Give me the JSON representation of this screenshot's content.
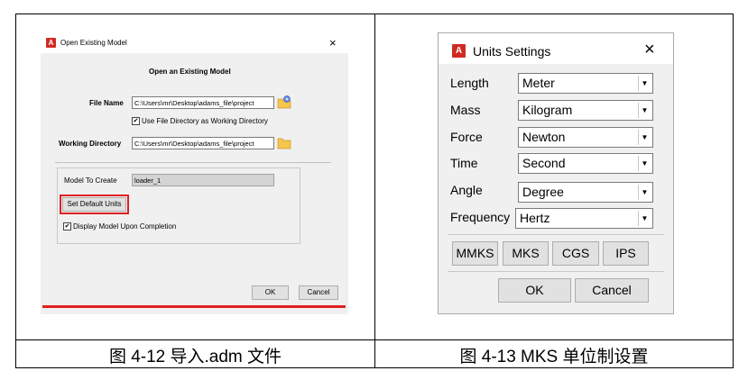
{
  "open_dialog": {
    "title": "Open Existing Model",
    "close_glyph": "×",
    "heading": "Open an Existing Model",
    "file_name_label": "File Name",
    "file_name_value": "C:\\Users\\mr\\Desktop\\adams_file\\project",
    "use_file_dir_label": "Use File Directory as Working Directory",
    "use_file_dir_checked": true,
    "working_dir_label": "Working Directory",
    "working_dir_value": "C:\\Users\\mr\\Desktop\\adams_file\\project",
    "model_to_create_label": "Model To Create",
    "model_to_create_value": "loader_1",
    "set_default_units_label": "Set Default Units",
    "display_model_label": "Display Model Upon Completion",
    "display_model_checked": true,
    "ok_label": "OK",
    "cancel_label": "Cancel",
    "app_icon_letter": "A"
  },
  "units_dialog": {
    "title": "Units Settings",
    "close_glyph": "×",
    "app_icon_letter": "A",
    "rows": [
      {
        "label": "Length",
        "value": "Meter"
      },
      {
        "label": "Mass",
        "value": "Kilogram"
      },
      {
        "label": "Force",
        "value": "Newton"
      },
      {
        "label": "Time",
        "value": "Second"
      },
      {
        "label": "Angle",
        "value": "Degree"
      },
      {
        "label": "Frequency",
        "value": "Hertz"
      }
    ],
    "preset_buttons": [
      "MMKS",
      "MKS",
      "CGS",
      "IPS"
    ],
    "ok_label": "OK",
    "cancel_label": "Cancel"
  },
  "captions": {
    "left": "图 4-12 导入.adm 文件",
    "right": "图 4-13 MKS 单位制设置"
  },
  "colors": {
    "highlight_red": "#e02020",
    "app_icon_red": "#d12a22",
    "folder_yellow": "#f6c64a"
  }
}
